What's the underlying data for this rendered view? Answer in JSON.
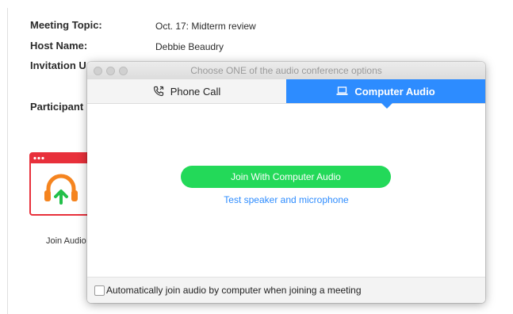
{
  "meeting": {
    "topic_label": "Meeting Topic:",
    "topic_value": "Oct. 17: Midterm review",
    "host_label": "Host Name:",
    "host_value": "Debbie Beaudry",
    "invitation_label": "Invitation U",
    "participant_label": "Participant"
  },
  "join_audio_tile": {
    "label": "Join Audio",
    "icon": "headphones-arrow-icon",
    "colors": {
      "frame": "#e8303b",
      "headphones": "#f5841f",
      "arrow": "#23c04a"
    }
  },
  "dialog": {
    "title": "Choose ONE of the audio conference options",
    "tabs": [
      {
        "label": "Phone Call",
        "icon": "phone-icon",
        "selected": false
      },
      {
        "label": "Computer Audio",
        "icon": "laptop-icon",
        "selected": true
      }
    ],
    "join_button": "Join With Computer Audio",
    "test_link": "Test speaker and microphone",
    "auto_join_label": "Automatically join audio by computer when joining a meeting",
    "auto_join_checked": false
  },
  "colors": {
    "accent": "#2d8cff",
    "join_button": "#23d959"
  }
}
